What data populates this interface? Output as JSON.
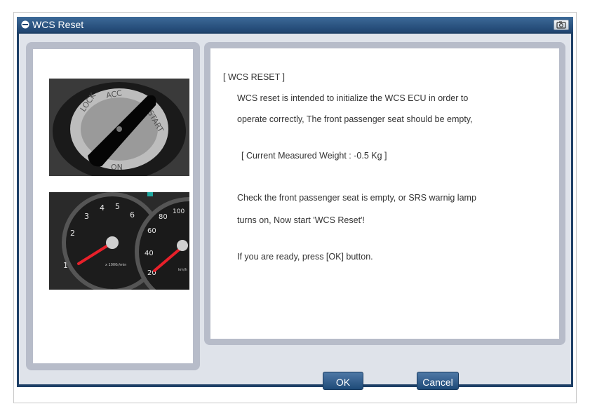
{
  "window": {
    "title": "WCS Reset"
  },
  "message": {
    "heading": "[ WCS RESET ]",
    "line1": "WCS reset is intended to initialize the WCS ECU in order to",
    "line2": "operate correctly,  The front passenger seat should be empty,",
    "weight": "[ Current Measured Weight :  -0.5 Kg ]",
    "line3": "Check the front passenger seat is empty, or SRS warnig lamp",
    "line4": "turns on,  Now start 'WCS Reset'!",
    "line5": "If you are ready, press [OK]  button."
  },
  "ignition_labels": [
    "LOCK",
    "ACC",
    "START",
    "ON"
  ],
  "gauge": {
    "tach_ticks": [
      "1",
      "2",
      "3",
      "4",
      "5",
      "6"
    ],
    "tach_unit": "x 1000r/min",
    "speed_ticks": [
      "20",
      "40",
      "60",
      "80",
      "100"
    ],
    "speed_unit": "km/h"
  },
  "buttons": {
    "ok": "OK",
    "cancel": "Cancel"
  },
  "colors": {
    "window": "#1d3f66",
    "panel": "#b7bcc9",
    "button": "#2c5a8a"
  }
}
